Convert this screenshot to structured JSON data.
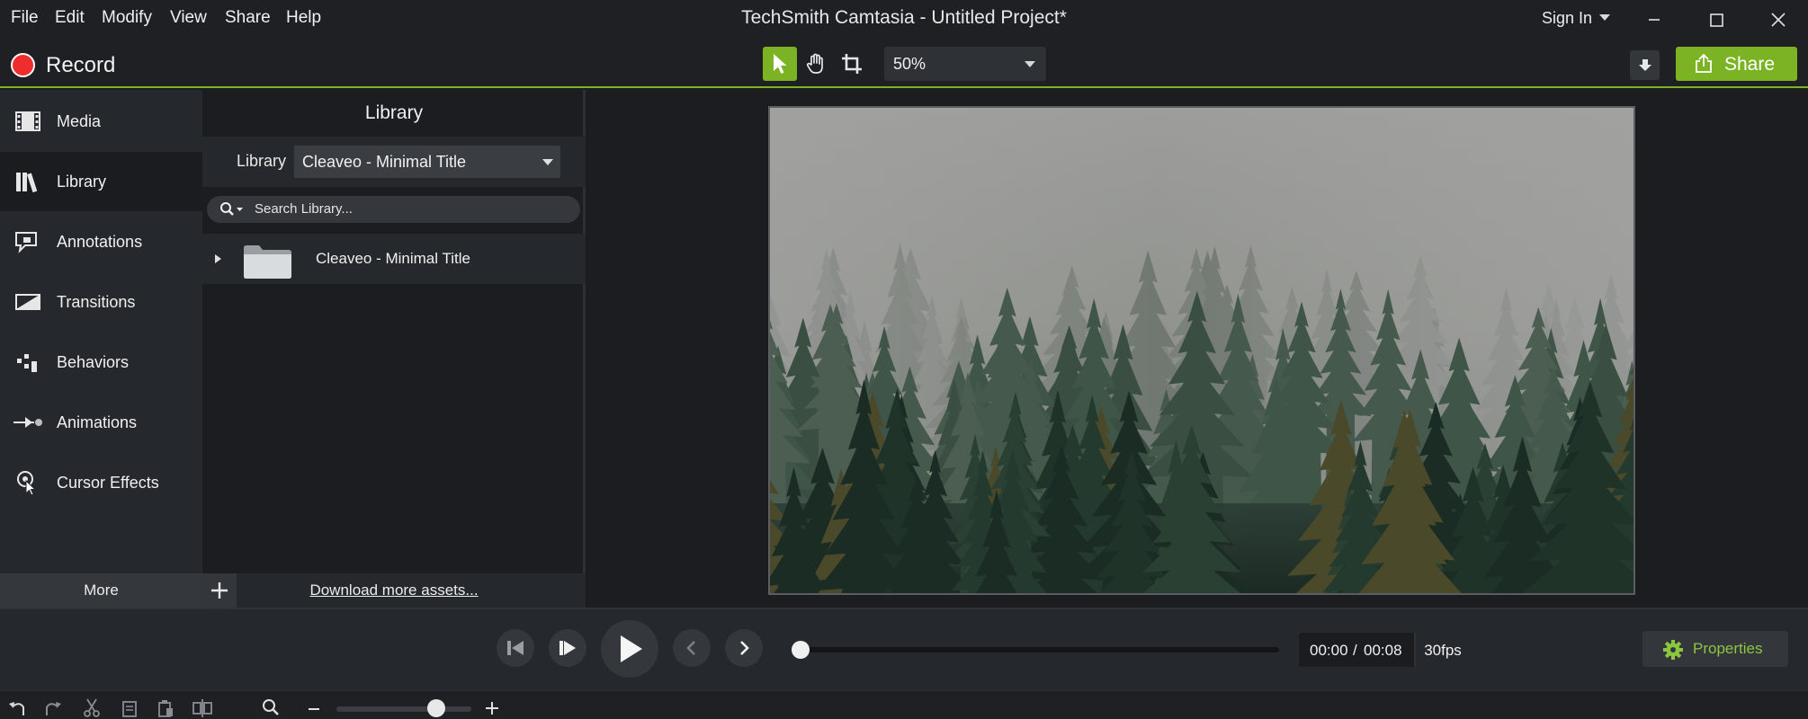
{
  "menu": {
    "items": [
      "File",
      "Edit",
      "Modify",
      "View",
      "Share",
      "Help"
    ]
  },
  "window": {
    "title": "TechSmith Camtasia - Untitled Project*",
    "sign_in": "Sign In"
  },
  "toolbar": {
    "record_label": "Record",
    "zoom_value": "50%",
    "share_label": "Share"
  },
  "sidebar": {
    "items": [
      {
        "label": "Media",
        "icon": "film-icon"
      },
      {
        "label": "Library",
        "icon": "books-icon"
      },
      {
        "label": "Annotations",
        "icon": "callout-icon"
      },
      {
        "label": "Transitions",
        "icon": "transition-icon"
      },
      {
        "label": "Behaviors",
        "icon": "behaviors-icon"
      },
      {
        "label": "Animations",
        "icon": "arrow-animation-icon"
      },
      {
        "label": "Cursor Effects",
        "icon": "cursor-effects-icon"
      }
    ],
    "active": "Library",
    "more_label": "More"
  },
  "library": {
    "heading": "Library",
    "filter_label": "Library",
    "selected_library": "Cleaveo - Minimal Title",
    "search_placeholder": "Search Library...",
    "folders": [
      {
        "label": "Cleaveo - Minimal Title"
      }
    ],
    "download_link": "Download more assets..."
  },
  "playback": {
    "time_current": "00:00",
    "time_separator": "/",
    "time_total": "00:08",
    "fps": "30fps",
    "properties_label": "Properties",
    "progress": 0
  },
  "colors": {
    "accent": "#7cb324",
    "record": "#ef2d2d",
    "properties_text": "#8cc63f"
  }
}
